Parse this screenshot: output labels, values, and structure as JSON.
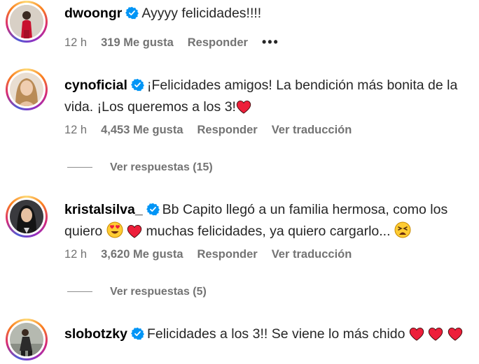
{
  "comments": [
    {
      "username": "dwoongr",
      "text": "Ayyyy felicidades!!!!",
      "time": "12 h",
      "likes": "319 Me gusta",
      "reply_label": "Responder",
      "more_label": "•••"
    },
    {
      "username": "cynoficial",
      "text": "¡Felicidades amigos! La bendición más bonita de la vida. ¡Los queremos a los 3!",
      "time": "12 h",
      "likes": "4,453 Me gusta",
      "reply_label": "Responder",
      "translate_label": "Ver traducción",
      "view_replies": "Ver respuestas (15)"
    },
    {
      "username": "kristalsilva_",
      "text_part1": "Bb Capito llegó a un familia hermosa, como los quiero",
      "text_part2": "muchas felicidades, ya quiero cargarlo...",
      "time": "12 h",
      "likes": "3,620 Me gusta",
      "reply_label": "Responder",
      "translate_label": "Ver traducción",
      "view_replies": "Ver respuestas (5)"
    },
    {
      "username": "slobotzky",
      "text": "Felicidades a los 3!! Se viene lo más chido"
    }
  ],
  "colors": {
    "verified": "#0095f6",
    "heart": "#ed1f3a",
    "meta": "#737373"
  }
}
